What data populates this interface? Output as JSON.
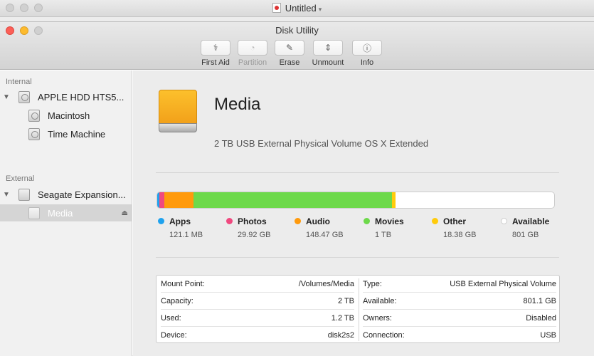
{
  "outer_window": {
    "title": "Untitled"
  },
  "window": {
    "title": "Disk Utility"
  },
  "toolbar": [
    {
      "label": "First Aid",
      "icon": "stethoscope-icon",
      "enabled": true
    },
    {
      "label": "Partition",
      "icon": "partition-icon",
      "enabled": false
    },
    {
      "label": "Erase",
      "icon": "erase-icon",
      "enabled": true
    },
    {
      "label": "Unmount",
      "icon": "unmount-icon",
      "enabled": true
    },
    {
      "label": "Info",
      "icon": "info-icon",
      "enabled": true
    }
  ],
  "sidebar": {
    "internal_header": "Internal",
    "external_header": "External",
    "internal_items": [
      {
        "label": "APPLE HDD HTS5...",
        "level": 0
      },
      {
        "label": "Macintosh",
        "level": 1
      },
      {
        "label": "Time Machine",
        "level": 1
      }
    ],
    "external_items": [
      {
        "label": "Seagate Expansion...",
        "level": 0
      },
      {
        "label": "Media",
        "level": 1,
        "selected": true
      }
    ]
  },
  "volume": {
    "name": "Media",
    "description": "2 TB USB External Physical Volume OS X Extended"
  },
  "usage": [
    {
      "name": "Apps",
      "value": "121.1 MB",
      "color": "#1fa2ee",
      "fraction": 0.0001
    },
    {
      "name": "Photos",
      "value": "29.92 GB",
      "color": "#f0497f",
      "fraction": 0.012
    },
    {
      "name": "Audio",
      "value": "148.47 GB",
      "color": "#ff9a0c",
      "fraction": 0.074
    },
    {
      "name": "Movies",
      "value": "1 TB",
      "color": "#6dd94a",
      "fraction": 0.5
    },
    {
      "name": "Other",
      "value": "18.38 GB",
      "color": "#ffcb0b",
      "fraction": 0.009
    },
    {
      "name": "Available",
      "value": "801 GB",
      "color": "#ffffff",
      "fraction": 0.405
    }
  ],
  "info": {
    "left": [
      {
        "key": "Mount Point:",
        "value": "/Volumes/Media"
      },
      {
        "key": "Capacity:",
        "value": "2 TB"
      },
      {
        "key": "Used:",
        "value": "1.2 TB"
      },
      {
        "key": "Device:",
        "value": "disk2s2"
      }
    ],
    "right": [
      {
        "key": "Type:",
        "value": "USB External Physical Volume"
      },
      {
        "key": "Available:",
        "value": "801.1 GB"
      },
      {
        "key": "Owners:",
        "value": "Disabled"
      },
      {
        "key": "Connection:",
        "value": "USB"
      }
    ]
  }
}
